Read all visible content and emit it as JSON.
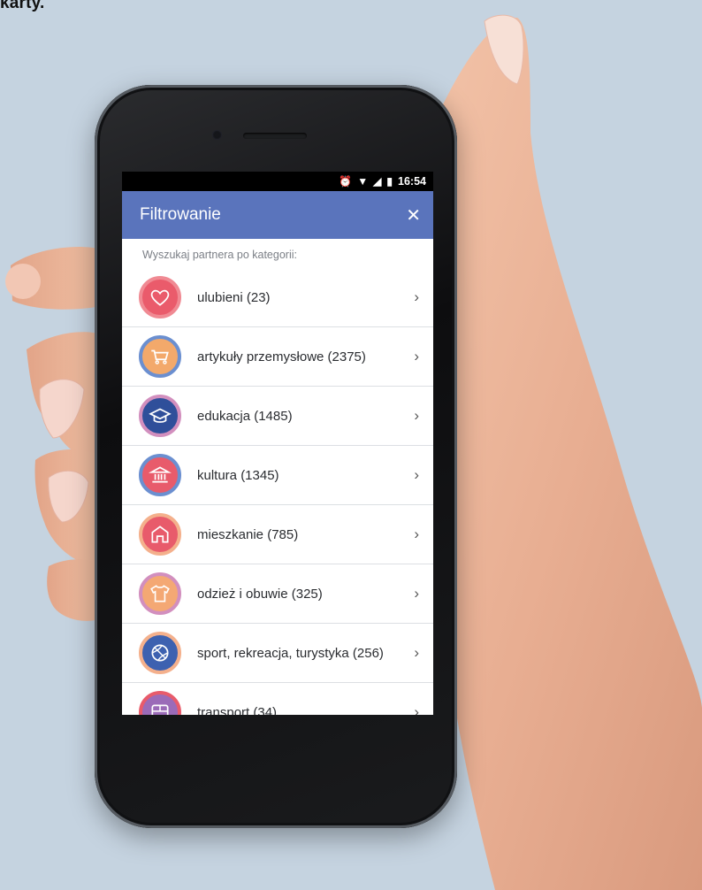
{
  "caption": "karty.",
  "status_bar": {
    "time": "16:54",
    "icons": [
      "alarm-icon",
      "wifi-icon",
      "signal-icon",
      "battery-icon"
    ]
  },
  "app_bar": {
    "title": "Filtrowanie",
    "close_icon": "close-icon"
  },
  "subtitle": "Wyszukaj partnera po kategorii:",
  "categories": [
    {
      "label": "ulubieni (23)",
      "icon": "heart-icon",
      "bg": "#ea5b6b",
      "ring": "#f08a93"
    },
    {
      "label": "artykuły przemysłowe (2375)",
      "icon": "cart-icon",
      "bg": "#f3a96b",
      "ring": "#6b8fd0"
    },
    {
      "label": "edukacja (1485)",
      "icon": "graduation-cap-icon",
      "bg": "#2f4f9a",
      "ring": "#d28fbe"
    },
    {
      "label": "kultura (1345)",
      "icon": "museum-icon",
      "bg": "#e85b6b",
      "ring": "#6b8fd0"
    },
    {
      "label": "mieszkanie (785)",
      "icon": "home-icon",
      "bg": "#e85b6b",
      "ring": "#f4b08c"
    },
    {
      "label": "odzież i obuwie (325)",
      "icon": "tshirt-icon",
      "bg": "#f4a874",
      "ring": "#d28fbe"
    },
    {
      "label": "sport, rekreacja, turystyka (256)",
      "icon": "ball-icon",
      "bg": "#3d61b0",
      "ring": "#f4b08c"
    },
    {
      "label": "transport (34)",
      "icon": "bus-icon",
      "bg": "#9b6bb8",
      "ring": "#e85b6b"
    }
  ],
  "chevron": "›"
}
